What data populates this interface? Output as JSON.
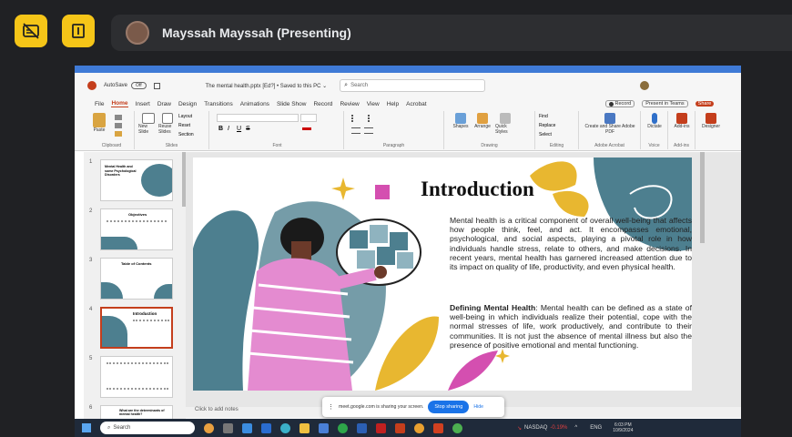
{
  "meet": {
    "presenter_name": "Mayssah Mayssah (Presenting)",
    "left_buttons": [
      "no-captions-icon",
      "present-icon"
    ]
  },
  "powerpoint": {
    "autosave_label": "AutoSave",
    "autosave_state": "Off",
    "file_title": "The mental health.pptx [Ed?] • Saved to this PC ⌄",
    "search_placeholder": "Search",
    "record_label": "Record",
    "present_teams_label": "Present in Teams",
    "share_label": "Share",
    "menu": [
      "File",
      "Home",
      "Insert",
      "Draw",
      "Design",
      "Transitions",
      "Animations",
      "Slide Show",
      "Record",
      "Review",
      "View",
      "Help",
      "Acrobat"
    ],
    "active_menu": "Home",
    "ribbon_groups": [
      "Clipboard",
      "Slides",
      "Font",
      "Paragraph",
      "Drawing",
      "Editing",
      "Adobe Acrobat",
      "Voice",
      "Add-ins"
    ],
    "ribbon_buttons": {
      "paste": "Paste",
      "new_slide": "New Slide",
      "reuse_slides": "Reuse Slides",
      "layout": "Layout",
      "reset": "Reset",
      "section": "Section",
      "shapes": "Shapes",
      "arrange": "Arrange",
      "quick_styles": "Quick Styles",
      "find": "Find",
      "replace": "Replace",
      "select": "Select",
      "create_share_pdf": "Create and Share Adobe PDF",
      "dictate": "Dictate",
      "addins": "Add-ins",
      "designer": "Designer"
    },
    "thumbnails": [
      {
        "num": "1",
        "title": "Mental Health and some Psychological Disorders"
      },
      {
        "num": "2",
        "title": "Objectives"
      },
      {
        "num": "3",
        "title": "Table of Contents"
      },
      {
        "num": "4",
        "title": "Introduction"
      },
      {
        "num": "5",
        "title": ""
      },
      {
        "num": "6",
        "title": "What are the determinants of mental health?"
      }
    ],
    "selected_slide": "4",
    "slide": {
      "title": "Introduction",
      "paragraph1": "Mental health is a critical component of overall well-being that affects how people think, feel, and act. It encompasses emotional, psychological, and social aspects, playing a pivotal role in how individuals handle stress, relate to others, and make decisions. In recent years, mental health has garnered increased attention due to its impact on quality of life, productivity, and even physical health.",
      "defining_label": "Defining Mental Health",
      "defining_text": ": Mental health can be defined as a state of well-being in which individuals realize their potential, cope with the normal stresses of life, work productively, and contribute to their communities. It is not just the absence of mental illness but also the presence of positive emotional and mental functioning."
    },
    "notes_placeholder": "Click to add notes"
  },
  "share_banner": {
    "text": "meet.google.com is sharing your screen.",
    "stop_label": "Stop sharing",
    "hide_label": "Hide"
  },
  "taskbar": {
    "search_placeholder": "Search",
    "stock_label": "NASDAQ",
    "stock_change": "-0.19%",
    "language": "ENG",
    "time": "6:03 PM",
    "date": "10/9/2024"
  },
  "colors": {
    "meet_accent": "#f5c518",
    "ppt_accent": "#c43e1c",
    "slide_teal": "#4d7f8f",
    "slide_yellow": "#e8b730",
    "slide_pink": "#d44fb0",
    "stop_button": "#1a73e8"
  }
}
